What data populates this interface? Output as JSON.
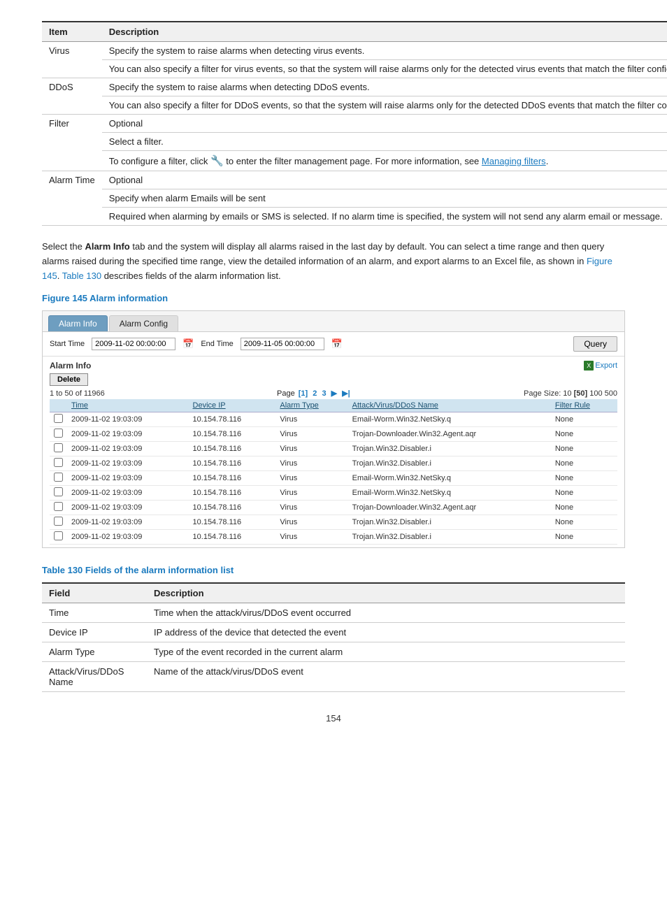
{
  "top_table": {
    "col1_header": "Item",
    "col2_header": "Description",
    "rows": [
      {
        "item": "Virus",
        "descriptions": [
          "Specify the system to raise alarms when detecting virus events.",
          "You can also specify a filter for virus events, so that the system will raise alarms only for the detected virus events that match the filter configurations."
        ]
      },
      {
        "item": "DDoS",
        "descriptions": [
          "Specify the system to raise alarms when detecting DDoS events.",
          "You can also specify a filter for DDoS events, so that the system will raise alarms only for the detected DDoS events that match the filter configurations."
        ]
      },
      {
        "item": "Filter",
        "descriptions": [
          "Optional",
          "Select a filter.",
          "To configure a filter, click 📄 to enter the filter management page. For more information, see \"Managing filters.\""
        ]
      },
      {
        "item": "Alarm Time",
        "descriptions": [
          "Optional",
          "Specify when alarm Emails will be sent",
          "Required when alarming by emails or SMS is selected. If no alarm time is specified, the system will not send any alarm email or message."
        ]
      }
    ]
  },
  "body_text": "Select the Alarm Info tab and the system will display all alarms raised in the last day by default. You can select a time range and then query alarms raised during the specified time range, view the detailed information of an alarm, and export alarms to an Excel file, as shown in Figure 145. Table 130 describes fields of the alarm information list.",
  "body_text_bold": "Alarm Info",
  "body_text_link1": "Figure 145",
  "body_text_link2": "Table 130",
  "figure_caption": "Figure 145 Alarm information",
  "ui": {
    "tabs": [
      {
        "label": "Alarm Info",
        "active": true
      },
      {
        "label": "Alarm Config",
        "active": false
      }
    ],
    "toolbar": {
      "start_label": "Start Time",
      "start_value": "2009-11-02 00:00:00",
      "end_label": "End Time",
      "end_value": "2009-11-05 00:00:00",
      "query_btn": "Query"
    },
    "alarm_info_title": "Alarm Info",
    "export_label": "Export",
    "delete_btn": "Delete",
    "pagination": {
      "range": "1 to 50 of 11966",
      "pages": [
        "1",
        "2",
        "3"
      ],
      "current_page": "1",
      "next": "▶",
      "last": "▶|",
      "page_size_label": "Page Size:",
      "sizes": [
        "10",
        "50",
        "100",
        "500"
      ],
      "current_size": "50"
    },
    "table_headers": [
      "",
      "Time",
      "Device IP",
      "Alarm Type",
      "Attack/Virus/DDoS Name",
      "Filter Rule"
    ],
    "table_rows": [
      {
        "time": "2009-11-02 19:03:09",
        "device_ip": "10.154.78.116",
        "alarm_type": "Virus",
        "name": "Email-Worm.Win32.NetSky.q",
        "filter_rule": "None"
      },
      {
        "time": "2009-11-02 19:03:09",
        "device_ip": "10.154.78.116",
        "alarm_type": "Virus",
        "name": "Trojan-Downloader.Win32.Agent.aqr",
        "filter_rule": "None"
      },
      {
        "time": "2009-11-02 19:03:09",
        "device_ip": "10.154.78.116",
        "alarm_type": "Virus",
        "name": "Trojan.Win32.Disabler.i",
        "filter_rule": "None"
      },
      {
        "time": "2009-11-02 19:03:09",
        "device_ip": "10.154.78.116",
        "alarm_type": "Virus",
        "name": "Trojan.Win32.Disabler.i",
        "filter_rule": "None"
      },
      {
        "time": "2009-11-02 19:03:09",
        "device_ip": "10.154.78.116",
        "alarm_type": "Virus",
        "name": "Email-Worm.Win32.NetSky.q",
        "filter_rule": "None"
      },
      {
        "time": "2009-11-02 19:03:09",
        "device_ip": "10.154.78.116",
        "alarm_type": "Virus",
        "name": "Email-Worm.Win32.NetSky.q",
        "filter_rule": "None"
      },
      {
        "time": "2009-11-02 19:03:09",
        "device_ip": "10.154.78.116",
        "alarm_type": "Virus",
        "name": "Trojan-Downloader.Win32.Agent.aqr",
        "filter_rule": "None"
      },
      {
        "time": "2009-11-02 19:03:09",
        "device_ip": "10.154.78.116",
        "alarm_type": "Virus",
        "name": "Trojan.Win32.Disabler.i",
        "filter_rule": "None"
      },
      {
        "time": "2009-11-02 19:03:09",
        "device_ip": "10.154.78.116",
        "alarm_type": "Virus",
        "name": "Trojan.Win32.Disabler.i",
        "filter_rule": "None"
      }
    ]
  },
  "table_130_caption": "Table 130 Fields of the alarm information list",
  "table_130": {
    "col1_header": "Field",
    "col2_header": "Description",
    "rows": [
      {
        "field": "Time",
        "description": "Time when the attack/virus/DDoS event occurred"
      },
      {
        "field": "Device IP",
        "description": "IP address of the device that detected the event"
      },
      {
        "field": "Alarm Type",
        "description": "Type of the event recorded in the current alarm"
      },
      {
        "field": "Attack/Virus/DDoS Name",
        "description": "Name of the attack/virus/DDoS event"
      }
    ]
  },
  "page_number": "154"
}
